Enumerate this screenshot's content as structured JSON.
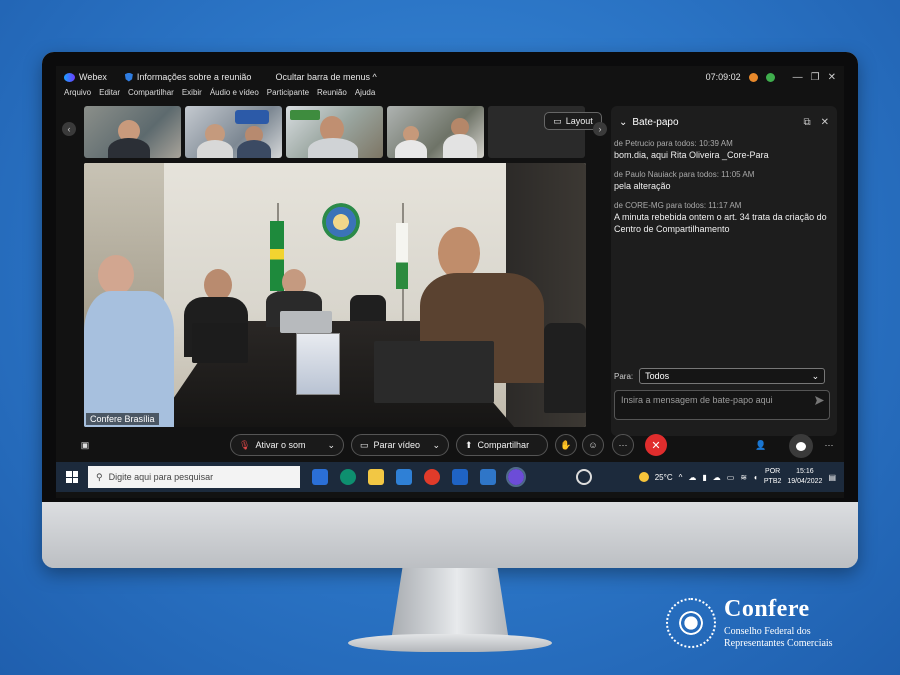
{
  "titlebar": {
    "app_name": "Webex",
    "meeting_info": "Informações sobre a reunião",
    "hide_menu": "Ocultar barra de menus",
    "time": "07:09:02"
  },
  "menu": [
    "Arquivo",
    "Editar",
    "Compartilhar",
    "Exibir",
    "Áudio e vídeo",
    "Participante",
    "Reunião",
    "Ajuda"
  ],
  "layout_button": "Layout",
  "main_video": {
    "participant_name": "Confere Brasília"
  },
  "chat": {
    "title": "Bate-papo",
    "messages": [
      {
        "meta": "de Petrucio para todos:   10:39 AM",
        "text": "bom.dia, aqui Rita Oliveira _Core-Para"
      },
      {
        "meta": "de Paulo Nauiack para todos:   11:05 AM",
        "text": "pela alteração"
      },
      {
        "meta": "de CORE-MG para todos:   11:17 AM",
        "text": "A minuta rebebida ontem o art. 34 trata da criação do Centro de Compartilhamento"
      }
    ],
    "to_label": "Para:",
    "to_value": "Todos",
    "input_placeholder": "Insira a mensagem de bate-papo aqui"
  },
  "controls": {
    "unmute": "Ativar o som",
    "stop_video": "Parar vídeo",
    "share": "Compartilhar"
  },
  "taskbar": {
    "search_placeholder": "Digite aqui para pesquisar",
    "temperature": "25°C",
    "lang_1": "POR",
    "lang_2": "PTB2",
    "clock_time": "15:16",
    "clock_date": "19/04/2022"
  },
  "brand": {
    "name": "Confere",
    "line1": "Conselho Federal dos",
    "line2": "Representantes Comerciais"
  },
  "colors": {
    "background": "#2a73c4",
    "end_call": "#e02d2d",
    "screen": "#121212"
  }
}
